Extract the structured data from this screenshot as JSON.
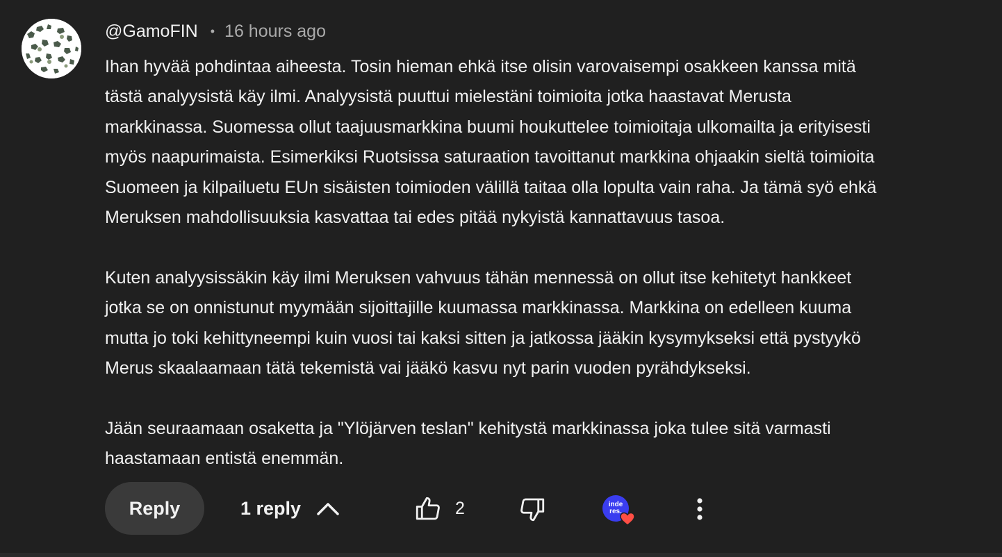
{
  "comment": {
    "author": "@GamoFIN",
    "separator": "•",
    "time": "16 hours ago",
    "paragraphs": [
      [
        "Ihan hyvää pohdintaa aiheesta. Tosin hieman ehkä itse olisin varovaisempi osakkeen kanssa mitä",
        "tästä analyysistä käy ilmi. Analyysistä puuttui mielestäni toimioita jotka haastavat Merusta",
        "markkinassa. Suomessa ollut taajuusmarkkina buumi houkuttelee toimioitaja ulkomailta ja erityisesti",
        "myös naapurimaista. Esimerkiksi Ruotsissa saturaation tavoittanut markkina ohjaakin sieltä toimioita",
        "Suomeen ja kilpailuetu EUn sisäisten toimioden välillä taitaa olla lopulta vain raha. Ja tämä syö ehkä",
        "Meruksen mahdollisuuksia kasvattaa tai edes pitää nykyistä kannattavuus tasoa."
      ],
      [
        "Kuten analyysissäkin käy ilmi Meruksen vahvuus tähän mennessä on ollut itse kehitetyt hankkeet",
        "jotka se on onnistunut myymään sijoittajille kuumassa markkinassa. Markkina on edelleen kuuma",
        "mutta jo toki kehittyneempi kuin vuosi tai kaksi sitten ja jatkossa jääkin kysymykseksi että pystyykö",
        "Merus skaalaamaan tätä tekemistä vai jääkö kasvu nyt parin vuoden pyrähdykseksi."
      ],
      [
        "Jään seuraamaan osaketta ja \"Ylöjärven teslan\" kehitystä markkinassa joka tulee sitä varmasti",
        "haastamaan entistä enemmän."
      ]
    ]
  },
  "actions": {
    "reply_label": "Reply",
    "replies_label": "1 reply",
    "like_count": "2",
    "badge_text_1": "inde",
    "badge_text_2": "res.",
    "icons": [
      "thumb-up-icon",
      "thumb-down-icon",
      "chevron-up-icon",
      "heart-icon",
      "more-vert-icon"
    ]
  },
  "colors": {
    "background": "#202020",
    "text": "#f1f1f1",
    "muted": "#aaaaaa",
    "button": "#3a3a3a",
    "badge": "#3a3df0",
    "heart": "#ff4e45"
  }
}
